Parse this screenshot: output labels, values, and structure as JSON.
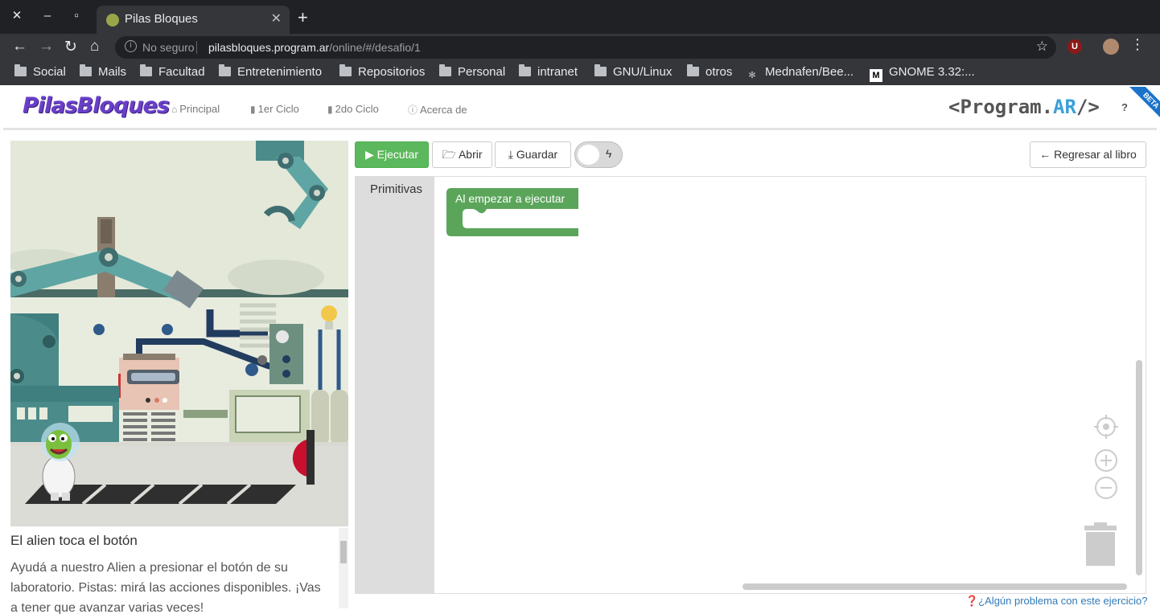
{
  "browser": {
    "tab_title": "Pilas Bloques",
    "tab_close": "✕",
    "new_tab": "+",
    "window_close": "✕",
    "window_minimize": "–",
    "window_maximize": "▫",
    "not_secure": "No seguro",
    "url_host": "pilasbloques.program.ar",
    "url_path": "/online/#/desafio/1",
    "extension_badge": "U",
    "bookmarks": [
      "Social",
      "Mails",
      "Facultad",
      "Entretenimiento",
      "Repositorios",
      "Personal",
      "intranet",
      "GNU/Linux",
      "otros",
      "Mednafen/Bee...",
      "GNOME 3.32:..."
    ],
    "gnome_icon_letter": "M"
  },
  "app": {
    "logo": "PilasBloques",
    "nav": [
      {
        "label": "Principal",
        "icon": "home-icon"
      },
      {
        "label": "1er Ciclo",
        "icon": "book-icon"
      },
      {
        "label": "2do Ciclo",
        "icon": "book-icon"
      },
      {
        "label": "Acerca de",
        "icon": "info-icon"
      }
    ],
    "brand_prefix": "<Program.",
    "brand_accent": "AR",
    "brand_suffix": "/>",
    "help": "?",
    "beta": "BETA"
  },
  "challenge": {
    "title": "El alien toca el botón",
    "description": "Ayudá a nuestro Alien a presionar el botón de su laboratorio. Pistas: mirá las acciones disponibles. ¡Vas a tener que avanzar varias veces!"
  },
  "toolbar": {
    "run": "Ejecutar",
    "open": "Abrir",
    "save": "Guardar",
    "back": "Regresar al libro"
  },
  "workspace": {
    "category": "Primitivas",
    "start_block": "Al empezar a ejecutar"
  },
  "footer": {
    "problem_link": "¿Algún problema con este ejercicio?"
  },
  "colors": {
    "run_green": "#5cb85c",
    "block_green": "#5ba55b",
    "logo_purple": "#6a3fc8",
    "link_blue": "#337ab7"
  }
}
